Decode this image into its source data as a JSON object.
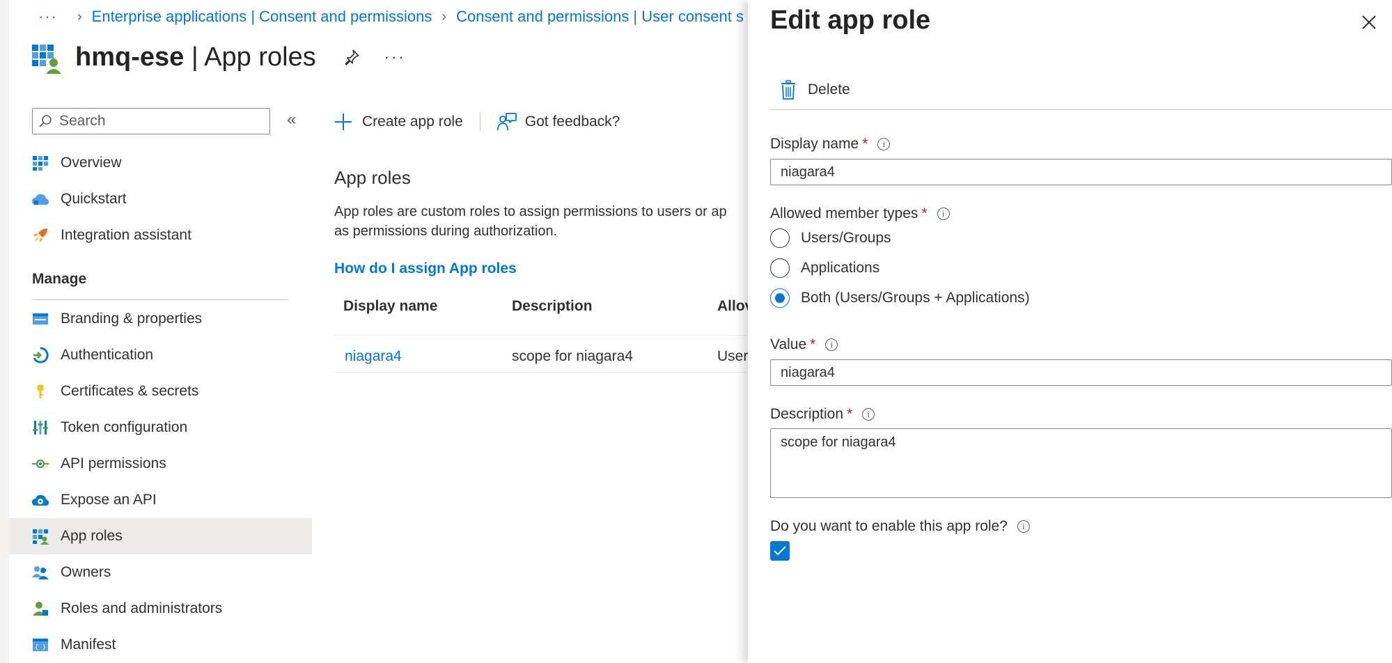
{
  "breadcrumb": {
    "items": [
      "Enterprise applications | Consent and permissions",
      "Consent and permissions | User consent s"
    ]
  },
  "page": {
    "app_name": "hmq-ese",
    "section": "App roles",
    "title_separator": " | "
  },
  "search": {
    "placeholder": "Search"
  },
  "sidebar": {
    "items_top": [
      {
        "label": "Overview",
        "icon": "grid-icon"
      },
      {
        "label": "Quickstart",
        "icon": "cloud-icon"
      },
      {
        "label": "Integration assistant",
        "icon": "rocket-icon"
      }
    ],
    "manage_header": "Manage",
    "items_manage": [
      {
        "label": "Branding & properties",
        "icon": "card-icon"
      },
      {
        "label": "Authentication",
        "icon": "auth-icon"
      },
      {
        "label": "Certificates & secrets",
        "icon": "key-icon"
      },
      {
        "label": "Token configuration",
        "icon": "sliders-icon"
      },
      {
        "label": "API permissions",
        "icon": "api-icon"
      },
      {
        "label": "Expose an API",
        "icon": "cloud-api-icon"
      },
      {
        "label": "App roles",
        "icon": "grid-user-icon",
        "active": true
      },
      {
        "label": "Owners",
        "icon": "users-icon"
      },
      {
        "label": "Roles and administrators",
        "icon": "user-admin-icon"
      },
      {
        "label": "Manifest",
        "icon": "manifest-icon"
      }
    ]
  },
  "toolbar": {
    "create_label": "Create app role",
    "feedback_label": "Got feedback?"
  },
  "content": {
    "section_title": "App roles",
    "description_line1": "App roles are custom roles to assign permissions to users or ap",
    "description_line2": "as permissions during authorization.",
    "help_link": "How do I assign App roles"
  },
  "table": {
    "headers": [
      "Display name",
      "Description",
      "Allov"
    ],
    "rows": [
      {
        "display_name": "niagara4",
        "description": "scope for niagara4",
        "allowed": "Users"
      }
    ]
  },
  "panel": {
    "title": "Edit app role",
    "delete_label": "Delete",
    "display_name_label": "Display name",
    "display_name_value": "niagara4",
    "member_types_label": "Allowed member types",
    "member_options": [
      {
        "label": "Users/Groups",
        "checked": false
      },
      {
        "label": "Applications",
        "checked": false
      },
      {
        "label": "Both (Users/Groups + Applications)",
        "checked": true
      }
    ],
    "value_label": "Value",
    "value_value": "niagara4",
    "description_label": "Description",
    "description_value": "scope for niagara4",
    "enable_label": "Do you want to enable this app role?",
    "enable_checked": true,
    "required_mark": "*",
    "info_glyph": "i"
  },
  "colors": {
    "accent": "#0078d4",
    "required": "#a4262c",
    "active_nav": "#edebe9"
  }
}
